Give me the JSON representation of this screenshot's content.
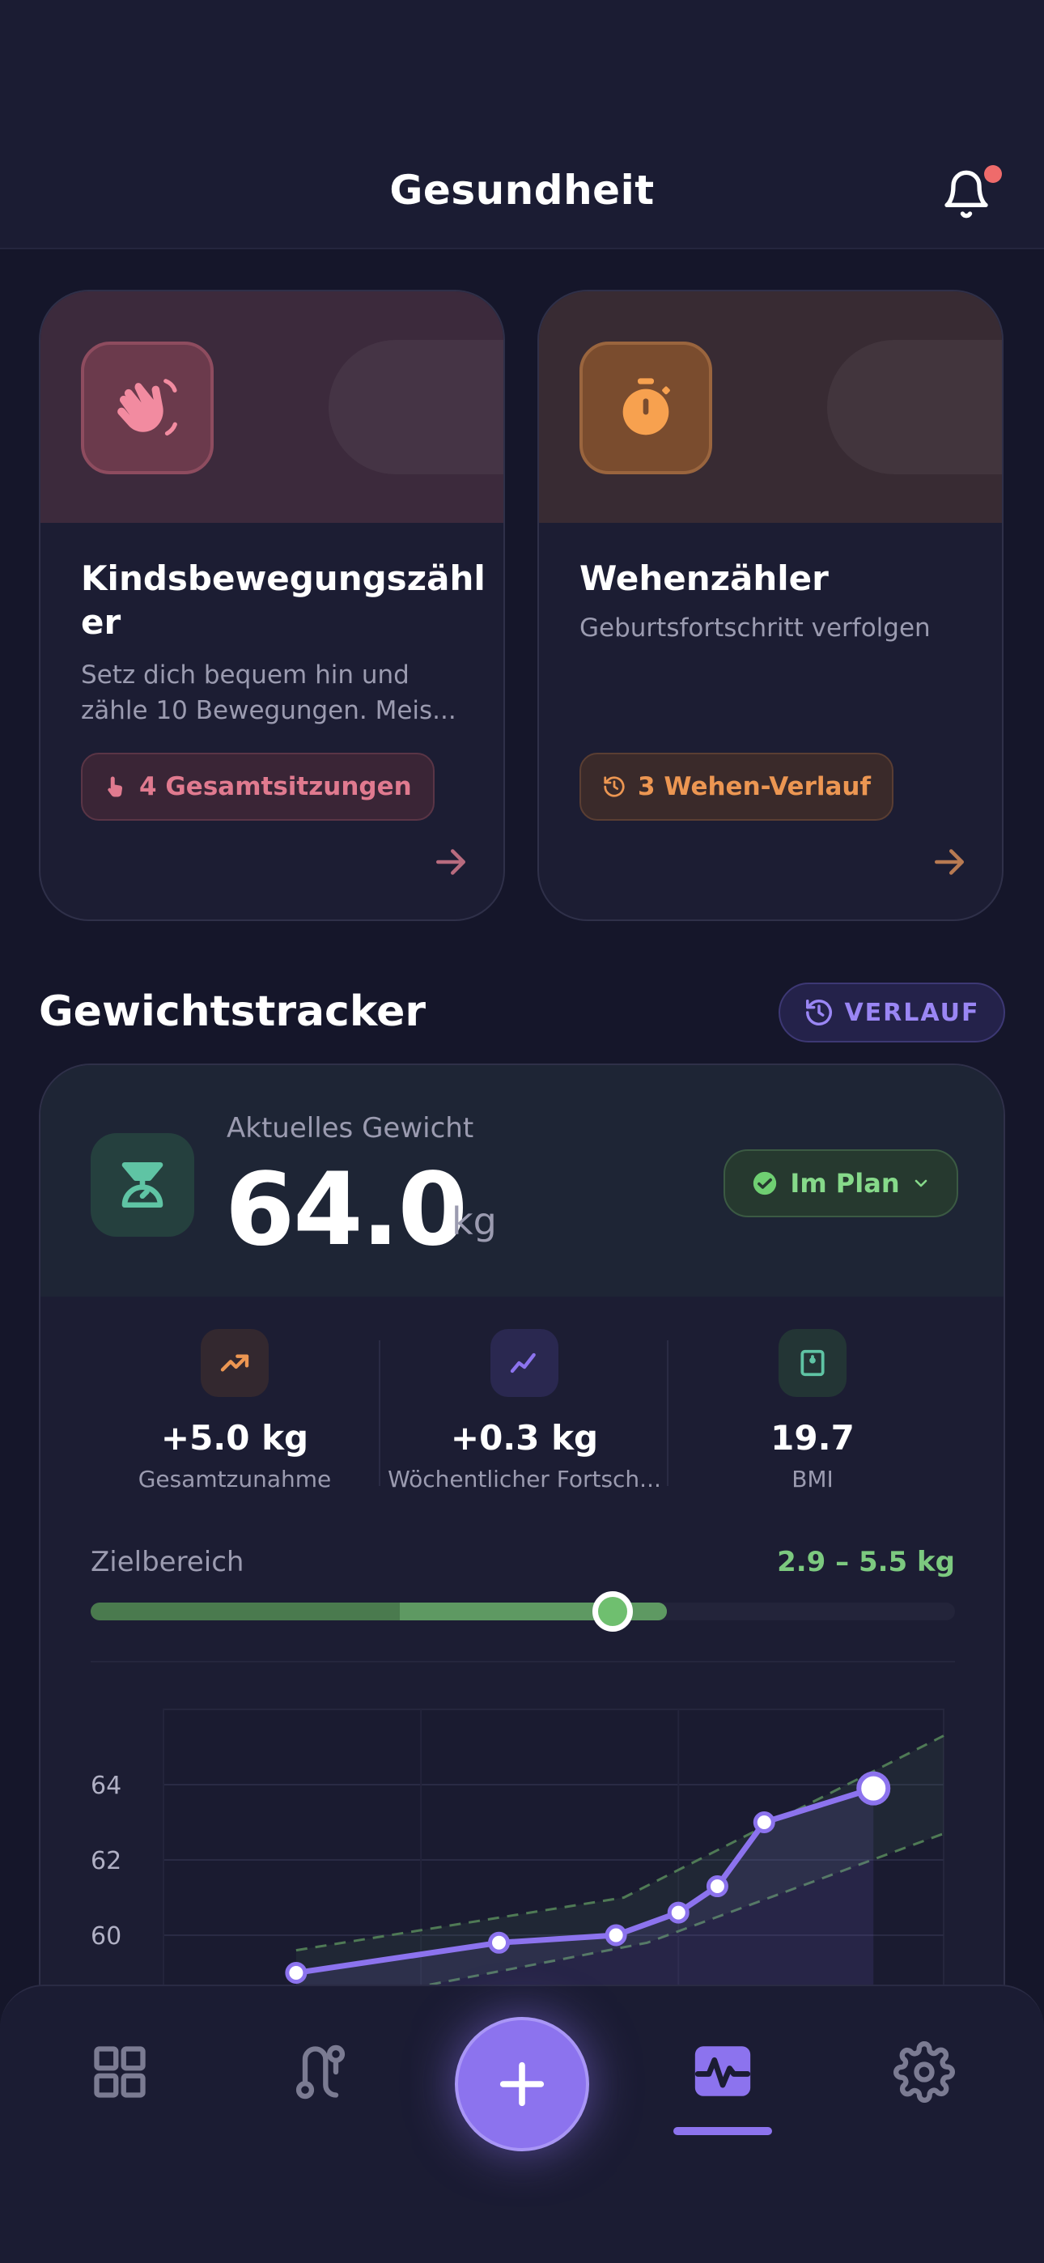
{
  "header": {
    "title": "Gesundheit"
  },
  "cards": [
    {
      "title": "Kindsbewegungszähl­er",
      "title_display": "Kindsbewegungszähl er",
      "description": "Setz dich bequem hin und zähle 10 Bewegungen. Meis...",
      "pill": "4 Gesamtsitzungen",
      "icon": "hand-wave-icon",
      "accent": "#e07a8f"
    },
    {
      "title": "Wehenzähler",
      "description": "Geburtsfortschritt verfolgen",
      "pill": "3 Wehen-Verlauf",
      "icon": "stopwatch-icon",
      "accent": "#ec9652"
    }
  ],
  "weight": {
    "section_title": "Gewichtstracker",
    "history_button": "VERLAUF",
    "current_label": "Aktuelles Gewicht",
    "current_value": "64.0",
    "unit": "kg",
    "status": "Im Plan",
    "stats": [
      {
        "value": "+5.0 kg",
        "label": "Gesamtzunahme",
        "icon": "trending-up-icon"
      },
      {
        "value": "+0.3 kg",
        "label": "Wöchentlicher Fortsch...",
        "icon": "line-chart-icon"
      },
      {
        "value": "19.7",
        "label": "BMI",
        "icon": "scale-box-icon"
      }
    ],
    "target_label": "Zielbereich",
    "target_range": "2.9 – 5.5 kg",
    "target_progress": 0.6
  },
  "chart_data": {
    "type": "line",
    "y_ticks": [
      "64",
      "62",
      "60"
    ],
    "ylim": [
      56,
      66
    ],
    "series": [
      {
        "values": [
          {
            "x": 0.17,
            "y": 59.0
          },
          {
            "x": 0.43,
            "y": 59.8
          },
          {
            "x": 0.58,
            "y": 60.0
          },
          {
            "x": 0.66,
            "y": 60.6
          },
          {
            "x": 0.71,
            "y": 61.3
          },
          {
            "x": 0.77,
            "y": 63.0
          },
          {
            "x": 0.91,
            "y": 63.9
          }
        ]
      }
    ],
    "band_upper": [
      {
        "x": 0.17,
        "y": 59.6
      },
      {
        "x": 0.59,
        "y": 61.0
      },
      {
        "x": 1.0,
        "y": 65.3
      }
    ],
    "band_lower": [
      {
        "x": 0.17,
        "y": 58.0
      },
      {
        "x": 0.62,
        "y": 59.8
      },
      {
        "x": 1.0,
        "y": 62.7
      }
    ],
    "grid": true
  },
  "nav": {
    "items": [
      "dashboard-icon",
      "route-icon",
      "add-icon",
      "health-icon",
      "settings-icon"
    ],
    "active": "health-icon"
  },
  "colors": {
    "background": "#15162a",
    "accent": "#8c73ee",
    "green": "#7cc97f"
  }
}
